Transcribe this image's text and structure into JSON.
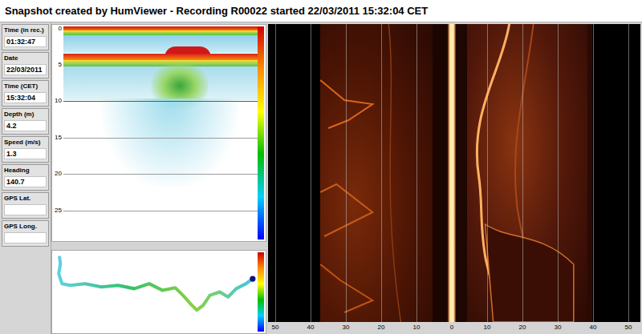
{
  "window": {
    "title": "Snapshot created by HumViewer - Recording R00022 started 22/03/2011 15:32:04 CET"
  },
  "readouts": [
    {
      "label": "Time (in rec.)",
      "value": "01:32:47"
    },
    {
      "label": "Date",
      "value": "22/03/2011"
    },
    {
      "label": "Time (CET)",
      "value": "15:32:04"
    },
    {
      "label": "Depth (m)",
      "value": "4.2"
    },
    {
      "label": "Speed (m/s)",
      "value": "1.3"
    },
    {
      "label": "Heading",
      "value": "140.7"
    },
    {
      "label": "GPS Lat.",
      "value": ""
    },
    {
      "label": "GPS Long.",
      "value": ""
    }
  ],
  "down_sonar": {
    "depth_ticks": [
      "0",
      "5",
      "10",
      "15",
      "20",
      "25"
    ]
  },
  "side_sonar": {
    "range_ticks": [
      "50",
      "40",
      "30",
      "20",
      "10",
      "0",
      "10",
      "20",
      "30",
      "40",
      "50"
    ]
  }
}
